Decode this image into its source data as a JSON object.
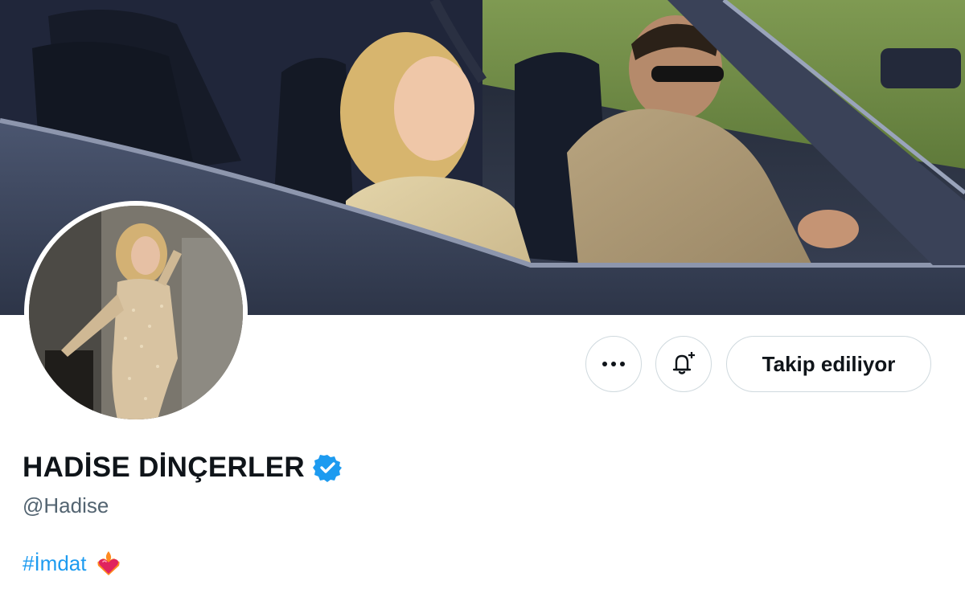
{
  "profile": {
    "display_name": "HADİSE DİNÇERLER",
    "handle": "@Hadise",
    "verified": true,
    "bio_hashtag": "#İmdat",
    "bio_emoji": "heart-on-fire-emoji"
  },
  "actions": {
    "more_icon": "more-horizontal-icon",
    "notify_icon": "bell-plus-icon",
    "follow_label": "Takip ediliyor"
  },
  "colors": {
    "accent": "#1d9bf0",
    "text_primary": "#0f1419",
    "text_secondary": "#536471",
    "border": "#cfd9de"
  }
}
